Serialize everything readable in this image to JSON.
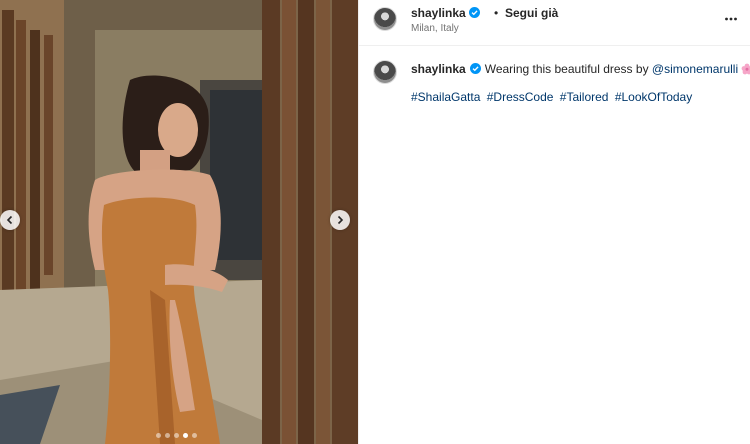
{
  "post": {
    "username": "shaylinka",
    "separator": "•",
    "follow_label": "Segui già",
    "location": "Milan, Italy",
    "more_icon": "more-horizontal-icon",
    "verified_color": "#0095f6"
  },
  "caption": {
    "username": "shaylinka",
    "text_before_mention": "Wearing this beautiful dress by ",
    "mention": "@simonemarulli",
    "emoji_icon": "pink-flower-icon",
    "hashtags": [
      "#ShailaGatta",
      "#DressCode",
      "#Tailored",
      "#LookOfToday"
    ]
  },
  "carousel": {
    "total_slides": 5,
    "active_index": 3,
    "prev_icon": "chevron-left-icon",
    "next_icon": "chevron-right-icon"
  },
  "colors": {
    "link": "#00376b",
    "text": "#262626",
    "muted": "#737373",
    "dress": "#c07a3a"
  }
}
